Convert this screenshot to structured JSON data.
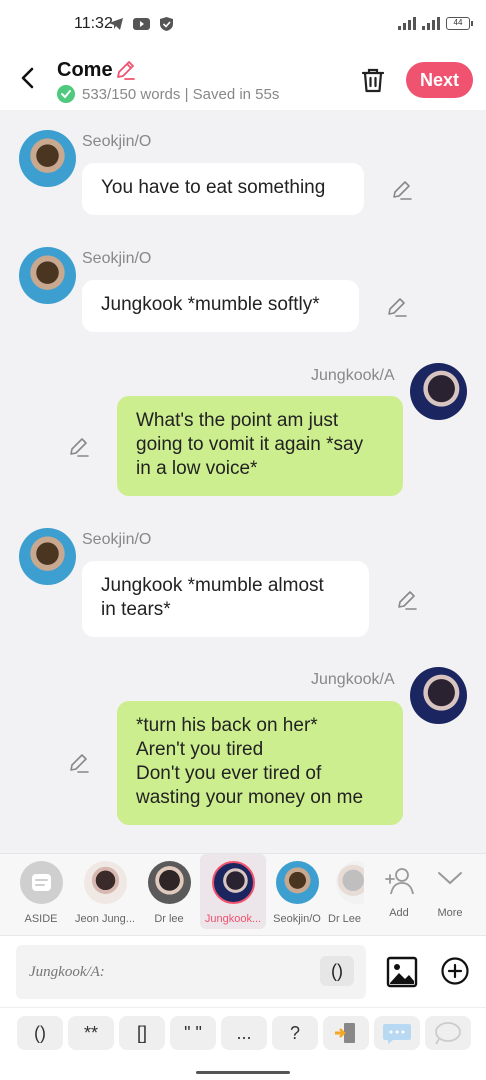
{
  "status_bar": {
    "time": "11:32",
    "battery": "44"
  },
  "header": {
    "title": "Come",
    "status": "533/150 words | Saved in 55s",
    "next_label": "Next"
  },
  "messages": [
    {
      "speaker": "Seokjin/O",
      "text": "You have to eat something",
      "side": "left"
    },
    {
      "speaker": "Seokjin/O",
      "text": "Jungkook *mumble softly*",
      "side": "left"
    },
    {
      "speaker": "Jungkook/A",
      "lines": [
        "What's the point am just",
        "going to vomit it again *say",
        "in a low voice*"
      ],
      "side": "right"
    },
    {
      "speaker": "Seokjin/O",
      "lines": [
        "Jungkook *mumble almost",
        "in tears*"
      ],
      "side": "left"
    },
    {
      "speaker": "Jungkook/A",
      "lines": [
        "*turn his back on her*",
        "Aren't you tired",
        "Don't you ever tired of",
        "wasting your money on me"
      ],
      "side": "right"
    }
  ],
  "characters": [
    {
      "label": "ASIDE"
    },
    {
      "label": "Jeon Jung..."
    },
    {
      "label": "Dr lee"
    },
    {
      "label": "Jungkook..."
    },
    {
      "label": "Seokjin/O"
    },
    {
      "label": "Dr Lee"
    },
    {
      "label": "Add"
    },
    {
      "label": "More"
    }
  ],
  "input": {
    "placeholder": "Jungkook/A:",
    "paren": "()"
  },
  "symbols": [
    "()",
    "**",
    "[]",
    "\" \"",
    "...",
    "?"
  ],
  "colors": {
    "accent": "#f0536f",
    "green_bubble": "#cdee8f",
    "saved_check": "#4fc97e"
  }
}
